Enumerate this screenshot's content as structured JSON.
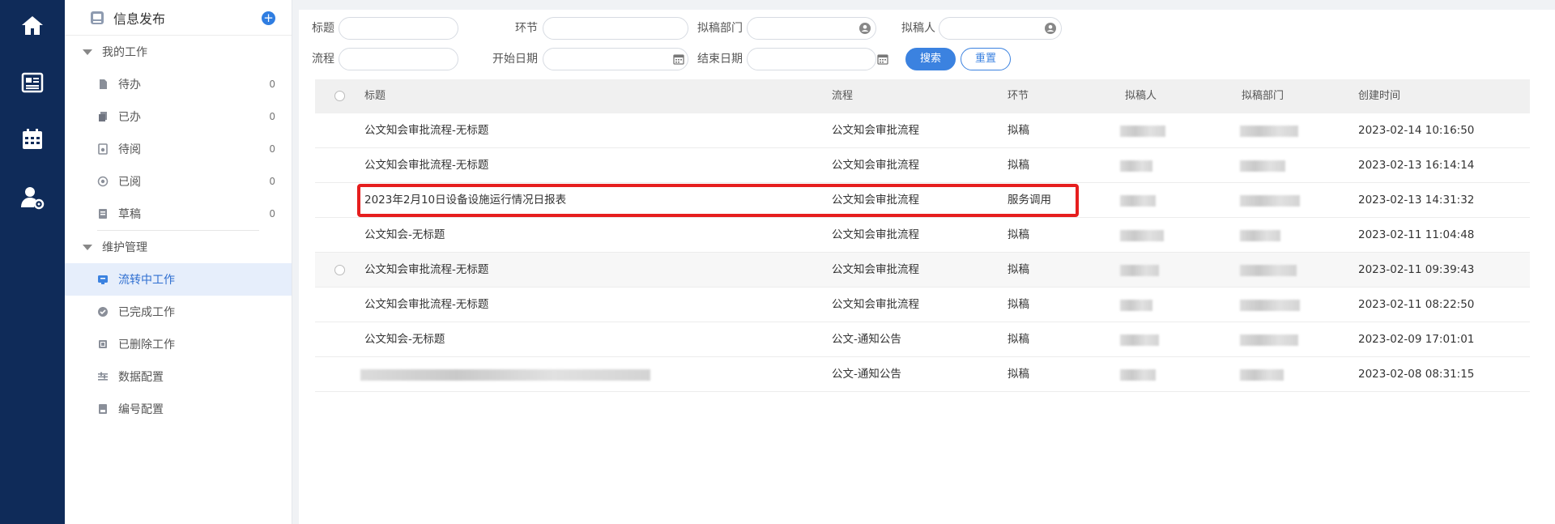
{
  "rail": {
    "icons": [
      "home-icon",
      "news-icon",
      "calendar-icon",
      "user-settings-icon"
    ]
  },
  "sidebar": {
    "title": "信息发布",
    "add_icon": "plus-icon",
    "groups": [
      {
        "label": "我的工作",
        "items": [
          {
            "label": "待办",
            "count": "0",
            "icon": "todo-icon"
          },
          {
            "label": "已办",
            "count": "0",
            "icon": "done-icon"
          },
          {
            "label": "待阅",
            "count": "0",
            "icon": "to-read-icon"
          },
          {
            "label": "已阅",
            "count": "0",
            "icon": "read-icon"
          },
          {
            "label": "草稿",
            "count": "0",
            "icon": "draft-icon"
          }
        ]
      },
      {
        "label": "维护管理",
        "items": [
          {
            "label": "流转中工作",
            "icon": "in-progress-icon",
            "active": true
          },
          {
            "label": "已完成工作",
            "icon": "completed-icon"
          },
          {
            "label": "已删除工作",
            "icon": "deleted-icon"
          },
          {
            "label": "数据配置",
            "icon": "data-config-icon"
          },
          {
            "label": "编号配置",
            "icon": "number-config-icon"
          }
        ]
      }
    ]
  },
  "filters": {
    "title_label": "标题",
    "node_label": "环节",
    "dept_label": "拟稿部门",
    "drafter_label": "拟稿人",
    "flow_label": "流程",
    "start_label": "开始日期",
    "end_label": "结束日期",
    "search_btn": "搜索",
    "reset_btn": "重置"
  },
  "table": {
    "headers": [
      "标题",
      "流程",
      "环节",
      "拟稿人",
      "拟稿部门",
      "创建时间"
    ],
    "rows": [
      {
        "title": "公文知会审批流程-无标题",
        "flow": "公文知会审批流程",
        "node": "拟稿",
        "time": "2023-02-14 10:16:50"
      },
      {
        "title": "公文知会审批流程-无标题",
        "flow": "公文知会审批流程",
        "node": "拟稿",
        "time": "2023-02-13 16:14:14"
      },
      {
        "title": "2023年2月10日设备设施运行情况日报表",
        "flow": "公文知会审批流程",
        "node": "服务调用",
        "time": "2023-02-13 14:31:32",
        "highlighted": true
      },
      {
        "title": "公文知会-无标题",
        "flow": "公文知会审批流程",
        "node": "拟稿",
        "time": "2023-02-11 11:04:48"
      },
      {
        "title": "公文知会审批流程-无标题",
        "flow": "公文知会审批流程",
        "node": "拟稿",
        "time": "2023-02-11 09:39:43",
        "hover": true
      },
      {
        "title": "公文知会审批流程-无标题",
        "flow": "公文知会审批流程",
        "node": "拟稿",
        "time": "2023-02-11 08:22:50"
      },
      {
        "title": "公文知会-无标题",
        "flow": "公文-通知公告",
        "node": "拟稿",
        "time": "2023-02-09 17:01:01"
      },
      {
        "title": "",
        "flow": "公文-通知公告",
        "node": "拟稿",
        "time": "2023-02-08 08:31:15"
      }
    ]
  },
  "colors": {
    "rail_bg": "#0f2b59",
    "accent": "#3b82e0",
    "highlight": "#e61e1e"
  }
}
